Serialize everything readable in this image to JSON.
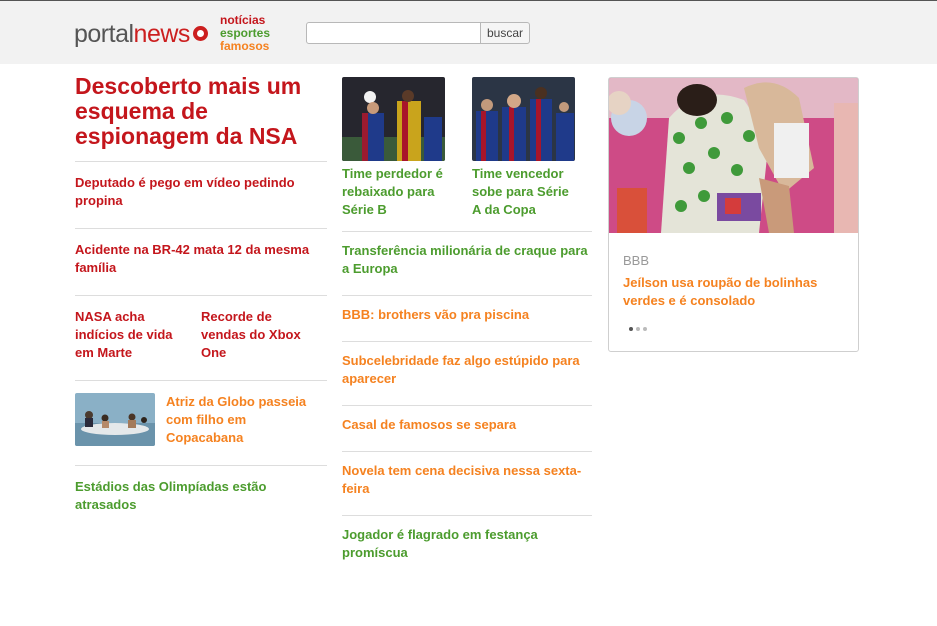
{
  "header": {
    "logo_part1": "portal",
    "logo_part2": "news",
    "nav": [
      "notícias",
      "esportes",
      "famosos"
    ],
    "search": {
      "value": "",
      "placeholder": "",
      "button": "buscar"
    }
  },
  "col1": {
    "headline": "Descoberto mais um esquema de espionagem da NSA",
    "items": [
      "Deputado é pego em vídeo pedindo propina",
      "Acidente na BR-42 mata 12 da mesma família"
    ],
    "pair": [
      "NASA acha indícios de vida em Marte",
      "Recorde de vendas do Xbox One"
    ],
    "thumb_story": "Atriz da Globo passeia com filho em Copacabana",
    "last": "Estádios das Olimpíadas estão atrasados"
  },
  "col2": {
    "pics": [
      {
        "caption": "Time perdedor é rebaixado para Série B"
      },
      {
        "caption": "Time vencedor sobe para Série A da Copa"
      }
    ],
    "items": [
      {
        "text": "Transferência milionária de craque para a Europa",
        "color": "green"
      },
      {
        "text": "BBB: brothers vão pra piscina",
        "color": "orange"
      },
      {
        "text": "Subcelebridade faz algo estúpido para aparecer",
        "color": "orange"
      },
      {
        "text": "Casal de famosos se separa",
        "color": "orange"
      },
      {
        "text": "Novela tem cena decisiva nessa sexta-feira",
        "color": "orange"
      },
      {
        "text": "Jogador é flagrado em festança promíscua",
        "color": "green"
      }
    ]
  },
  "card": {
    "label": "BBB",
    "text": "Jeílson usa roupão de bolinhas verdes e é consolado",
    "active_slide": 1,
    "slide_count": 3
  },
  "colors": {
    "news_red": "#c4161c",
    "sports_green": "#4c9c2e",
    "celebrity_orange": "#f58220"
  }
}
